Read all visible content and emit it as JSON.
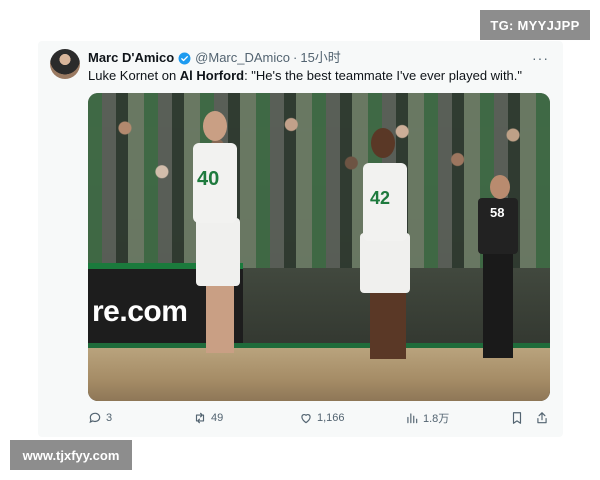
{
  "watermarks": {
    "top": "TG: MYYJJPP",
    "bottom": "www.tjxfyy.com"
  },
  "tweet": {
    "author_name": "Marc D'Amico",
    "handle": "@Marc_DAmico",
    "separator": "·",
    "time": "15小时",
    "more": "···",
    "text_prefix": "Luke Kornet on ",
    "text_mention": "Al Horford",
    "text_suffix": ": \"He's the best teammate I've ever played with.\"",
    "image": {
      "ad_board_text": "re.com",
      "jersey_numbers": [
        "40",
        "42"
      ],
      "referee_number": "58"
    },
    "actions": {
      "replies": "3",
      "retweets": "49",
      "likes": "1,166",
      "views": "1.8万"
    }
  },
  "colors": {
    "verified": "#1d9bf0",
    "secondary_text": "#536471",
    "celtics_green": "#1e7a3d"
  }
}
